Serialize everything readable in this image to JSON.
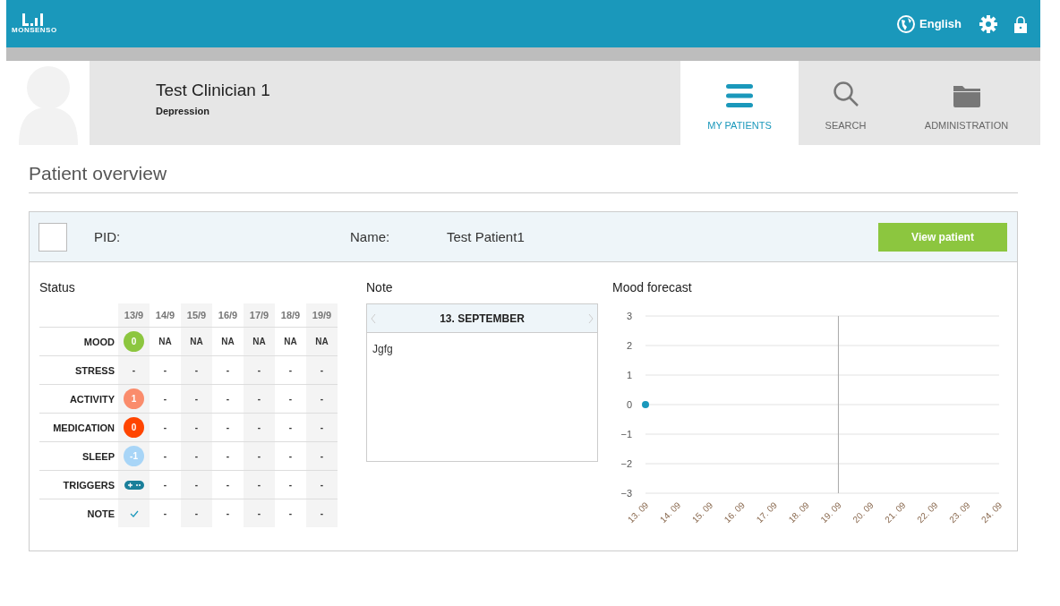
{
  "top_bar": {
    "logo_text": "MONSENSO",
    "language": "English"
  },
  "profile": {
    "name": "Test Clinician 1",
    "subtitle": "Depression"
  },
  "tabs": [
    {
      "label": "MY PATIENTS",
      "kind": "list",
      "selected": true
    },
    {
      "label": "SEARCH",
      "kind": "search",
      "selected": false
    },
    {
      "label": "ADMINISTRATION",
      "kind": "folder",
      "selected": false
    }
  ],
  "page_title": "Patient overview",
  "patient": {
    "pid_label": "PID:",
    "name_label": "Name:",
    "name": "Test Patient1",
    "checked": false,
    "button": "View patient"
  },
  "status": {
    "title": "Status",
    "days": [
      "13/9",
      "14/9",
      "15/9",
      "16/9",
      "17/9",
      "18/9",
      "19/9"
    ],
    "rows": [
      {
        "label": "MOOD",
        "cells": [
          {
            "kind": "value",
            "text": "0",
            "color": "#8cc63f"
          },
          {
            "kind": "text",
            "text": "NA"
          },
          {
            "kind": "text",
            "text": "NA"
          },
          {
            "kind": "text",
            "text": "NA"
          },
          {
            "kind": "text",
            "text": "NA"
          },
          {
            "kind": "text",
            "text": "NA"
          },
          {
            "kind": "text",
            "text": "NA"
          }
        ]
      },
      {
        "label": "STRESS",
        "cells": [
          {
            "kind": "text",
            "text": "-"
          },
          {
            "kind": "text",
            "text": "-"
          },
          {
            "kind": "text",
            "text": "-"
          },
          {
            "kind": "text",
            "text": "-"
          },
          {
            "kind": "text",
            "text": "-"
          },
          {
            "kind": "text",
            "text": "-"
          },
          {
            "kind": "text",
            "text": "-"
          }
        ]
      },
      {
        "label": "ACTIVITY",
        "cells": [
          {
            "kind": "value",
            "text": "1",
            "color": "#fa8c6c"
          },
          {
            "kind": "text",
            "text": "-"
          },
          {
            "kind": "text",
            "text": "-"
          },
          {
            "kind": "text",
            "text": "-"
          },
          {
            "kind": "text",
            "text": "-"
          },
          {
            "kind": "text",
            "text": "-"
          },
          {
            "kind": "text",
            "text": "-"
          }
        ]
      },
      {
        "label": "MEDICATION",
        "cells": [
          {
            "kind": "value",
            "text": "0",
            "color": "#ff4500"
          },
          {
            "kind": "text",
            "text": "-"
          },
          {
            "kind": "text",
            "text": "-"
          },
          {
            "kind": "text",
            "text": "-"
          },
          {
            "kind": "text",
            "text": "-"
          },
          {
            "kind": "text",
            "text": "-"
          },
          {
            "kind": "text",
            "text": "-"
          }
        ]
      },
      {
        "label": "SLEEP",
        "cells": [
          {
            "kind": "value",
            "text": "-1",
            "color": "#a8d5f7"
          },
          {
            "kind": "text",
            "text": "-"
          },
          {
            "kind": "text",
            "text": "-"
          },
          {
            "kind": "text",
            "text": "-"
          },
          {
            "kind": "text",
            "text": "-"
          },
          {
            "kind": "text",
            "text": "-"
          },
          {
            "kind": "text",
            "text": "-"
          }
        ]
      },
      {
        "label": "TRIGGERS",
        "cells": [
          {
            "kind": "triggers"
          },
          {
            "kind": "text",
            "text": "-"
          },
          {
            "kind": "text",
            "text": "-"
          },
          {
            "kind": "text",
            "text": "-"
          },
          {
            "kind": "text",
            "text": "-"
          },
          {
            "kind": "text",
            "text": "-"
          },
          {
            "kind": "text",
            "text": "-"
          }
        ]
      },
      {
        "label": "NOTE",
        "cells": [
          {
            "kind": "check"
          },
          {
            "kind": "text",
            "text": "-"
          },
          {
            "kind": "text",
            "text": "-"
          },
          {
            "kind": "text",
            "text": "-"
          },
          {
            "kind": "text",
            "text": "-"
          },
          {
            "kind": "text",
            "text": "-"
          },
          {
            "kind": "text",
            "text": "-"
          }
        ]
      }
    ]
  },
  "note": {
    "title": "Note",
    "date": "13. SEPTEMBER",
    "text": "Jgfg"
  },
  "mood_forecast": {
    "title": "Mood forecast",
    "chart_data": {
      "type": "scatter",
      "categories": [
        "13. 09",
        "14. 09",
        "15. 09",
        "16. 09",
        "17. 09",
        "18. 09",
        "19. 09",
        "20. 09",
        "21. 09",
        "22. 09",
        "23. 09",
        "24. 09"
      ],
      "grid": true,
      "ref_lines": [
        {
          "axis": "x",
          "value": "19. 09"
        }
      ],
      "series": [
        {
          "color": "#1a98bb",
          "values": [
            0,
            null,
            null,
            null,
            null,
            null,
            null,
            null,
            null,
            null,
            null,
            null
          ]
        }
      ],
      "ylim": [
        -3,
        3
      ],
      "yticks": [
        3,
        2,
        1,
        0,
        {
          "value": -1,
          "label": "−1"
        },
        {
          "value": -2,
          "label": "−2"
        },
        {
          "value": -3,
          "label": "−3"
        }
      ]
    }
  }
}
